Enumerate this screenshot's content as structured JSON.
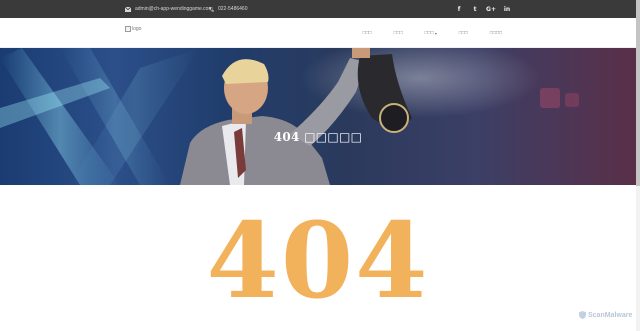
{
  "topbar": {
    "email": "admin@ch-app-wendinggame.com",
    "phone": "022-5486460",
    "social": [
      {
        "icon": "facebook-icon",
        "glyph": "f"
      },
      {
        "icon": "twitter-icon",
        "glyph": "t"
      },
      {
        "icon": "google-plus-icon",
        "glyph": "G+"
      },
      {
        "icon": "linkedin-icon",
        "glyph": "in"
      }
    ]
  },
  "header": {
    "logo_alt": "logo",
    "nav": [
      {
        "label": "□□□"
      },
      {
        "label": "□□□"
      },
      {
        "label": "□□□"
      },
      {
        "label": "□□□"
      },
      {
        "label": "□□□□"
      }
    ]
  },
  "hero": {
    "title": "404 □□□□□"
  },
  "error": {
    "code": "404"
  },
  "watermark": {
    "text": "ScanMalware"
  },
  "colors": {
    "topbar_bg": "#3a3a3a",
    "accent_404": "#f2b25b",
    "hero_base": "#203d6c"
  }
}
